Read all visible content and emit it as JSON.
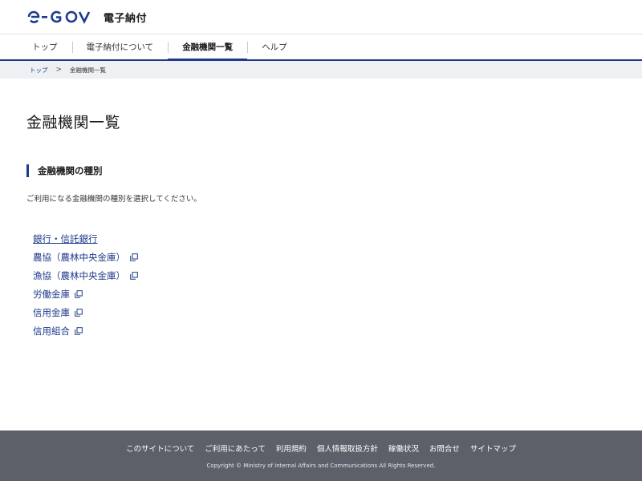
{
  "header": {
    "logo_text": "e-GOV",
    "site_title": "電子納付",
    "brand_color": "#1e3a8a"
  },
  "nav": {
    "items": [
      {
        "label": "トップ"
      },
      {
        "label": "電子納付について"
      },
      {
        "label": "金融機関一覧",
        "active": true
      },
      {
        "label": "ヘルプ"
      }
    ]
  },
  "breadcrumb": {
    "home": "トップ",
    "separator": ">",
    "current": "金融機関一覧"
  },
  "main": {
    "title": "金融機関一覧",
    "section_heading": "金融機関の種別",
    "intro": "ご利用になる金融機関の種別を選択してください。",
    "links": [
      {
        "label": "銀行・信託銀行",
        "external": false
      },
      {
        "label": "農協（農林中央金庫）",
        "external": true
      },
      {
        "label": "漁協（農林中央金庫）",
        "external": true
      },
      {
        "label": "労働金庫",
        "external": true
      },
      {
        "label": "信用金庫",
        "external": true
      },
      {
        "label": "信用組合",
        "external": true
      }
    ],
    "external_icon": "external-window-icon"
  },
  "footer": {
    "links": [
      {
        "label": "このサイトについて"
      },
      {
        "label": "ご利用にあたって"
      },
      {
        "label": "利用規約"
      },
      {
        "label": "個人情報取扱方針"
      },
      {
        "label": "稼働状況"
      },
      {
        "label": "お問合せ"
      },
      {
        "label": "サイトマップ"
      }
    ],
    "copyright": "Copyright © Ministry of Internal Affairs and Communications All Rights Reserved.",
    "background": "#5c6068"
  }
}
